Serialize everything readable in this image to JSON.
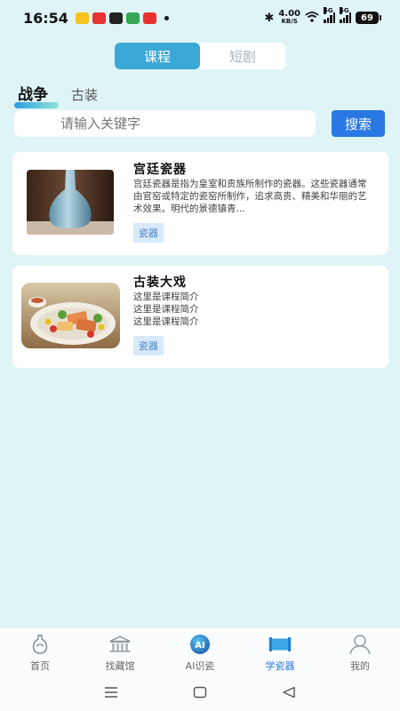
{
  "status_bar": {
    "time": "16:54",
    "net_speed_value": "4.00",
    "net_speed_unit": "KB/S",
    "signal1_label": "5G",
    "signal2_label": "5G",
    "battery": "69",
    "app_icon_colors": [
      "#f6c21b",
      "#e8322f",
      "#222222",
      "#35a853",
      "#e8322f"
    ]
  },
  "segment_tabs": [
    {
      "label": "课程",
      "active": true
    },
    {
      "label": "短剧",
      "active": false
    }
  ],
  "category_tabs": [
    {
      "label": "战争",
      "active": true
    },
    {
      "label": "古装",
      "active": false
    }
  ],
  "search": {
    "placeholder": "请输入关键字",
    "button_label": "搜索"
  },
  "courses": [
    {
      "title": "宫廷瓷器",
      "description": "宫廷瓷器是指为皇室和贵族所制作的瓷器。这些瓷器通常由官窑或特定的瓷窑所制作，追求高贵、精美和华丽的艺术效果。明代的景德镇青...",
      "tag": "瓷器",
      "image": "porcelain-vase"
    },
    {
      "title": "古装大戏",
      "description_lines": [
        "这里是课程简介",
        "这里是课程简介",
        "这里是课程简介"
      ],
      "tag": "瓷器",
      "image": "food-plate"
    }
  ],
  "bottom_nav": [
    {
      "label": "首页",
      "icon": "vase-home-icon",
      "active": false
    },
    {
      "label": "找藏馆",
      "icon": "museum-icon",
      "active": false
    },
    {
      "label": "AI识瓷",
      "icon": "ai-icon",
      "active": false
    },
    {
      "label": "学瓷器",
      "icon": "scroll-icon",
      "active": true
    },
    {
      "label": "我的",
      "icon": "user-icon",
      "active": false
    }
  ],
  "colors": {
    "background": "#dff4f7",
    "accent": "#3aa7d6",
    "search_button": "#2a78e4",
    "active_nav": "#2a78e4",
    "tag_bg": "#d8e9fb"
  }
}
